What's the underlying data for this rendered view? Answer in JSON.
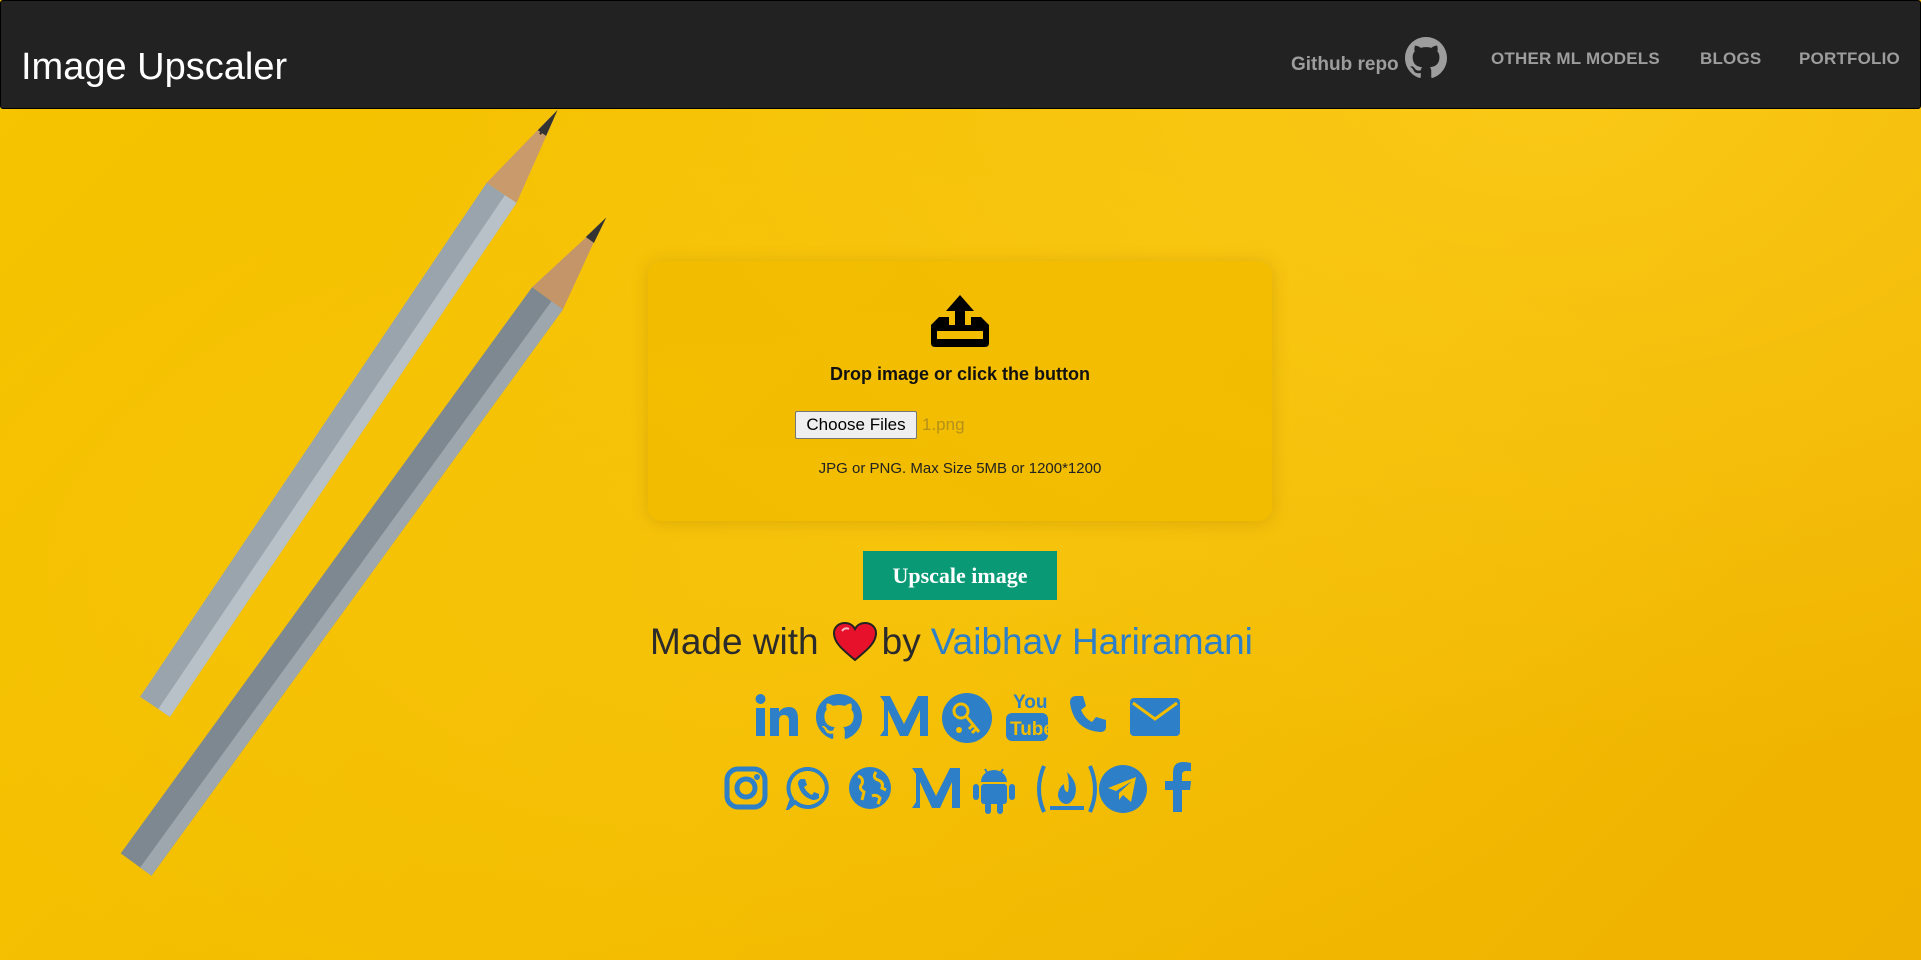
{
  "navbar": {
    "brand": "Image Upscaler",
    "github_text": "Github repo",
    "github_icon": "github-icon",
    "links": [
      "OTHER ML MODELS",
      "BLOGS",
      "PORTFOLIO"
    ]
  },
  "upload": {
    "icon": "upload-tray-icon",
    "prompt": "Drop image or click the button",
    "choose_button": "Choose Files",
    "file_name": "1.png",
    "hint": "JPG or PNG. Max Size 5MB or 1200*1200"
  },
  "upscale_button": "Upscale image",
  "credit": {
    "prefix": "Made with",
    "heart_icon": "heart-icon",
    "by": "by",
    "author": "Vaibhav Hariramani"
  },
  "social": {
    "color": "#2d7fc8",
    "row1": [
      "linkedin-icon",
      "github-icon",
      "medium-icon",
      "keybase-icon",
      "youtube-icon",
      "phone-icon",
      "email-icon"
    ],
    "row2": [
      "instagram-icon",
      "whatsapp-icon",
      "globe-icon",
      "medium-icon",
      "android-icon",
      "codepen-icon",
      "telegram-icon",
      "facebook-icon"
    ]
  },
  "colors": {
    "navbar_bg": "#222222",
    "background": "#f3bd00",
    "upscale_button_bg": "#099a75",
    "link_blue": "#2d7fc8"
  }
}
